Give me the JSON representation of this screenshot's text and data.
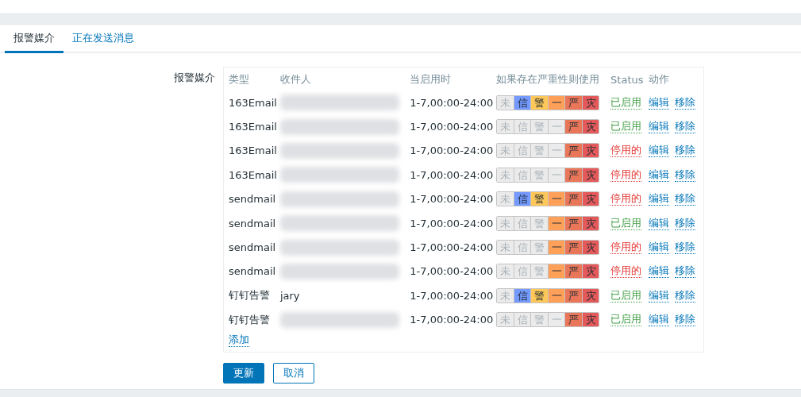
{
  "tabs": [
    {
      "label": "报警媒介",
      "selected": true
    },
    {
      "label": "正在发送消息",
      "selected": false
    }
  ],
  "form": {
    "label": "报警媒介",
    "columns": [
      "类型",
      "收件人",
      "当启用时",
      "如果存在严重性则使用",
      "Status",
      "动作"
    ],
    "rows": [
      {
        "type": "163Email",
        "redacted": true,
        "when": "1-7,00:00-24:00",
        "severities": [
          {
            "label": "未",
            "on": false
          },
          {
            "label": "信",
            "on": true
          },
          {
            "label": "警",
            "on": true
          },
          {
            "label": "一",
            "on": true
          },
          {
            "label": "严",
            "on": true
          },
          {
            "label": "灾",
            "on": true
          }
        ],
        "status": "已启用",
        "enabled": true,
        "actions": [
          "编辑",
          "移除"
        ]
      },
      {
        "type": "163Email",
        "redacted": true,
        "when": "1-7,00:00-24:00",
        "severities": [
          {
            "label": "未",
            "on": false
          },
          {
            "label": "信",
            "on": false
          },
          {
            "label": "警",
            "on": false
          },
          {
            "label": "一",
            "on": false
          },
          {
            "label": "严",
            "on": true
          },
          {
            "label": "灾",
            "on": true
          }
        ],
        "status": "已启用",
        "enabled": true,
        "actions": [
          "编辑",
          "移除"
        ]
      },
      {
        "type": "163Email",
        "redacted": true,
        "when": "1-7,00:00-24:00",
        "severities": [
          {
            "label": "未",
            "on": false
          },
          {
            "label": "信",
            "on": false
          },
          {
            "label": "警",
            "on": false
          },
          {
            "label": "一",
            "on": false
          },
          {
            "label": "严",
            "on": true
          },
          {
            "label": "灾",
            "on": true
          }
        ],
        "status": "停用的",
        "enabled": false,
        "actions": [
          "编辑",
          "移除"
        ]
      },
      {
        "type": "163Email",
        "redacted": true,
        "when": "1-7,00:00-24:00",
        "severities": [
          {
            "label": "未",
            "on": false
          },
          {
            "label": "信",
            "on": false
          },
          {
            "label": "警",
            "on": false
          },
          {
            "label": "一",
            "on": false
          },
          {
            "label": "严",
            "on": true
          },
          {
            "label": "灾",
            "on": true
          }
        ],
        "status": "停用的",
        "enabled": false,
        "actions": [
          "编辑",
          "移除"
        ]
      },
      {
        "type": "sendmail",
        "redacted": true,
        "when": "1-7,00:00-24:00",
        "severities": [
          {
            "label": "未",
            "on": false
          },
          {
            "label": "信",
            "on": true
          },
          {
            "label": "警",
            "on": true
          },
          {
            "label": "一",
            "on": true
          },
          {
            "label": "严",
            "on": true
          },
          {
            "label": "灾",
            "on": true
          }
        ],
        "status": "停用的",
        "enabled": false,
        "actions": [
          "编辑",
          "移除"
        ]
      },
      {
        "type": "sendmail",
        "redacted": true,
        "when": "1-7,00:00-24:00",
        "severities": [
          {
            "label": "未",
            "on": false
          },
          {
            "label": "信",
            "on": false
          },
          {
            "label": "警",
            "on": false
          },
          {
            "label": "一",
            "on": true
          },
          {
            "label": "严",
            "on": true
          },
          {
            "label": "灾",
            "on": true
          }
        ],
        "status": "已启用",
        "enabled": true,
        "actions": [
          "编辑",
          "移除"
        ]
      },
      {
        "type": "sendmail",
        "redacted": true,
        "when": "1-7,00:00-24:00",
        "severities": [
          {
            "label": "未",
            "on": false
          },
          {
            "label": "信",
            "on": false
          },
          {
            "label": "警",
            "on": false
          },
          {
            "label": "一",
            "on": true
          },
          {
            "label": "严",
            "on": true
          },
          {
            "label": "灾",
            "on": true
          }
        ],
        "status": "停用的",
        "enabled": false,
        "actions": [
          "编辑",
          "移除"
        ]
      },
      {
        "type": "sendmail",
        "redacted": true,
        "when": "1-7,00:00-24:00",
        "severities": [
          {
            "label": "未",
            "on": false
          },
          {
            "label": "信",
            "on": false
          },
          {
            "label": "警",
            "on": false
          },
          {
            "label": "一",
            "on": true
          },
          {
            "label": "严",
            "on": true
          },
          {
            "label": "灾",
            "on": true
          }
        ],
        "status": "停用的",
        "enabled": false,
        "actions": [
          "编辑",
          "移除"
        ]
      },
      {
        "type": "钉钉告警",
        "recipient": "jary",
        "when": "1-7,00:00-24:00",
        "severities": [
          {
            "label": "未",
            "on": false
          },
          {
            "label": "信",
            "on": true
          },
          {
            "label": "警",
            "on": true
          },
          {
            "label": "一",
            "on": true
          },
          {
            "label": "严",
            "on": true
          },
          {
            "label": "灾",
            "on": true
          }
        ],
        "status": "已启用",
        "enabled": true,
        "actions": [
          "编辑",
          "移除"
        ]
      },
      {
        "type": "钉钉告警",
        "redacted": true,
        "when": "1-7,00:00-24:00",
        "severities": [
          {
            "label": "未",
            "on": false
          },
          {
            "label": "信",
            "on": false
          },
          {
            "label": "警",
            "on": false
          },
          {
            "label": "一",
            "on": false
          },
          {
            "label": "严",
            "on": true
          },
          {
            "label": "灾",
            "on": true
          }
        ],
        "status": "已启用",
        "enabled": true,
        "actions": [
          "编辑",
          "移除"
        ]
      }
    ],
    "add_link": "添加"
  },
  "buttons": [
    {
      "label": "更新",
      "kind": "primary"
    },
    {
      "label": "取消",
      "kind": "secondary"
    }
  ]
}
